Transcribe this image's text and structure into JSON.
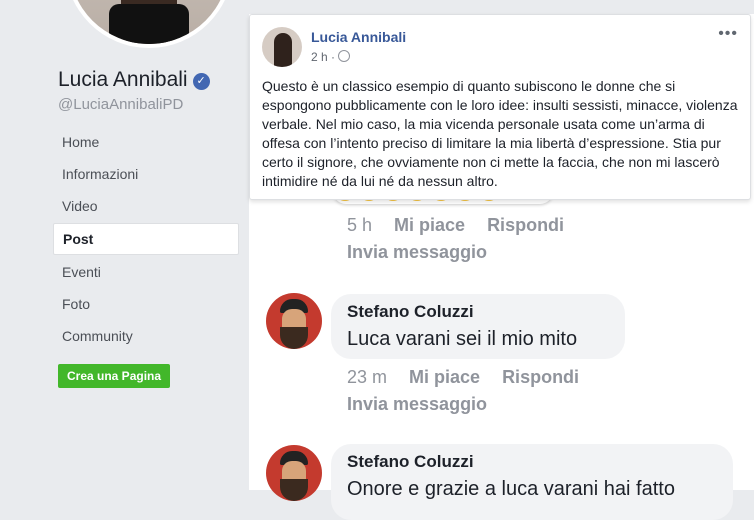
{
  "page": {
    "name": "Lucia Annibali",
    "handle": "@LuciaAnnibaliPD",
    "nav": [
      {
        "label": "Home",
        "active": false
      },
      {
        "label": "Informazioni",
        "active": false
      },
      {
        "label": "Video",
        "active": false
      },
      {
        "label": "Post",
        "active": true
      },
      {
        "label": "Eventi",
        "active": false
      },
      {
        "label": "Foto",
        "active": false
      },
      {
        "label": "Community",
        "active": false
      }
    ],
    "create_page": "Crea una Pagina"
  },
  "post": {
    "author": "Lucia Annibali",
    "time": "2 h ·",
    "menu": "•••",
    "text": "Questo è un classico esempio di quanto subiscono le donne che si espongono pubblicamente con le loro idee: insulti sessisti, minacce, violenza verbale. Nel mio caso, la mia vicenda personale usata come un’arma di offesa con l’intento preciso di limitare la mia libertà d’espressione. Stia pur certo il signore, che ovviamente non ci mette la faccia, che non mi lascerò intimidire né da lui né da nessun altro."
  },
  "comments": [
    {
      "time": "5 h",
      "like": "Mi piace",
      "reply": "Rispondi",
      "message": "Invia messaggio"
    },
    {
      "name": "Stefano Coluzzi",
      "text": "Luca varani sei il mio mito",
      "time": "23 m",
      "like": "Mi piace",
      "reply": "Rispondi",
      "message": "Invia messaggio"
    },
    {
      "name": "Stefano Coluzzi",
      "text": "Onore e grazie a luca varani hai fatto"
    }
  ],
  "colors": {
    "link": "#385898",
    "accent": "#4267b2",
    "green": "#42b72a"
  }
}
